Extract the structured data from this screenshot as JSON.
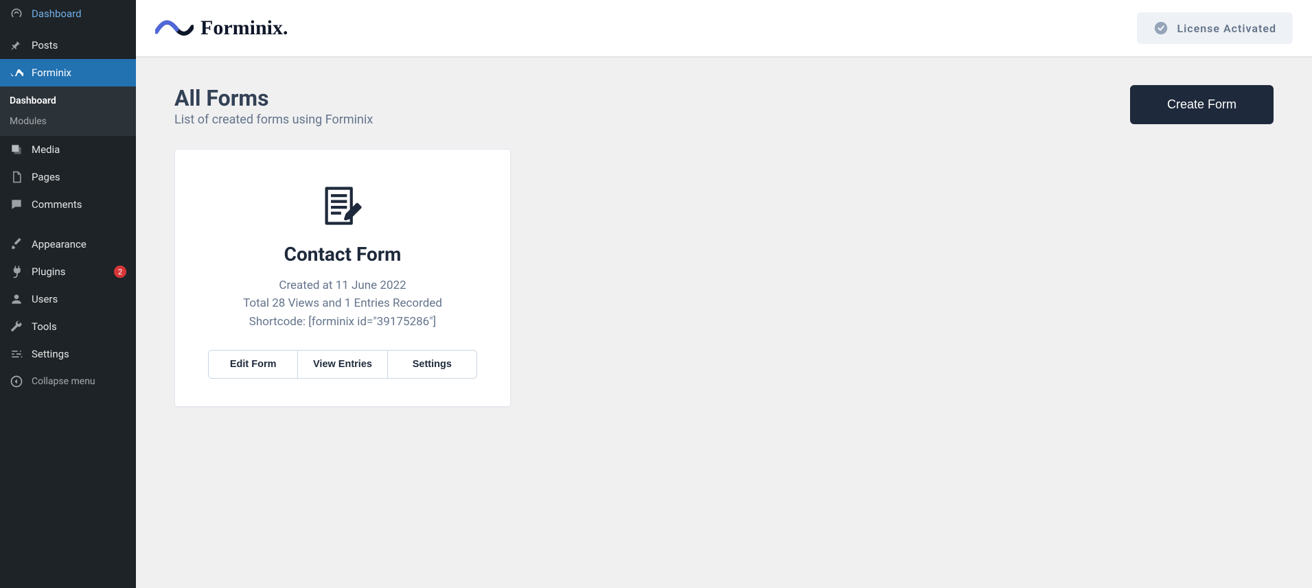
{
  "sidebar": {
    "items": [
      {
        "label": "Dashboard"
      },
      {
        "label": "Posts"
      },
      {
        "label": "Forminix"
      },
      {
        "label": "Media"
      },
      {
        "label": "Pages"
      },
      {
        "label": "Comments"
      },
      {
        "label": "Appearance"
      },
      {
        "label": "Plugins",
        "badge": "2"
      },
      {
        "label": "Users"
      },
      {
        "label": "Tools"
      },
      {
        "label": "Settings"
      }
    ],
    "submenu": {
      "items": [
        {
          "label": "Dashboard"
        },
        {
          "label": "Modules"
        }
      ]
    },
    "collapse_label": "Collapse menu"
  },
  "topbar": {
    "brand_name": "Forminix.",
    "license_label": "License Activated"
  },
  "page": {
    "title": "All Forms",
    "subtitle": "List of created forms using Forminix",
    "create_button": "Create Form"
  },
  "forms": [
    {
      "title": "Contact Form",
      "created_line": "Created at 11 June 2022",
      "stats_line": "Total 28 Views and 1 Entries Recorded",
      "shortcode_line": "Shortcode: [forminix id=\"39175286\"]",
      "actions": {
        "edit": "Edit Form",
        "entries": "View Entries",
        "settings": "Settings"
      }
    }
  ]
}
